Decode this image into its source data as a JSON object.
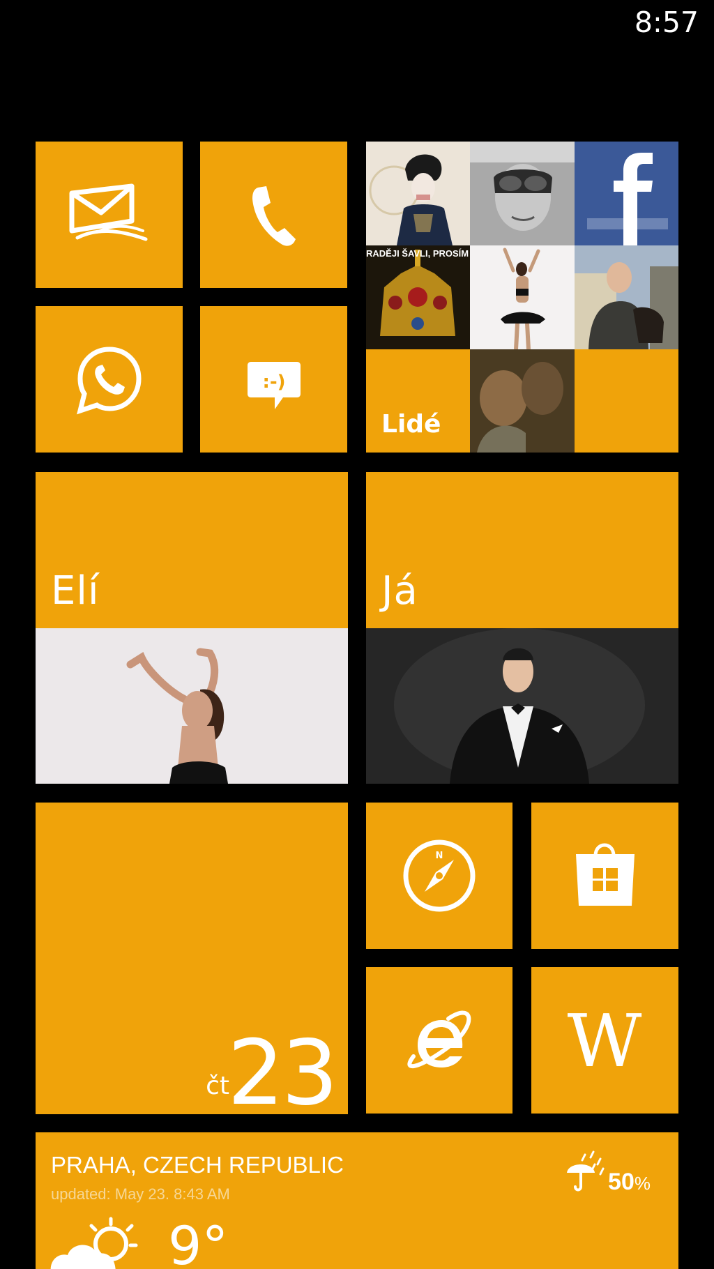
{
  "status_bar": {
    "time": "8:57"
  },
  "accent_color": "#F0A30A",
  "tiles": {
    "mail": {
      "icon": "mail-icon"
    },
    "phone": {
      "icon": "phone-icon"
    },
    "whatsapp": {
      "icon": "whatsapp-icon"
    },
    "messaging": {
      "icon": "messaging-icon",
      "glyph": ":-)"
    },
    "people": {
      "label": "Lidé",
      "photo_caption": "RADĚJI ŠAVLI, PROSÍM"
    },
    "eli": {
      "label": "Elí"
    },
    "ja": {
      "label": "Já"
    },
    "calendar": {
      "day_name": "čt",
      "day_number": "23"
    },
    "maps": {
      "icon": "compass-icon"
    },
    "store": {
      "icon": "store-icon"
    },
    "ie": {
      "icon": "internet-explorer-icon"
    },
    "wikipedia": {
      "icon": "wikipedia-icon",
      "glyph": "W"
    },
    "weather": {
      "city": "PRAHA, CZECH REPUBLIC",
      "updated": "updated: May 23. 8:43 AM",
      "precip_value": "50",
      "precip_unit": "%",
      "temperature": "9°",
      "icon": "partly-cloudy-icon"
    }
  }
}
